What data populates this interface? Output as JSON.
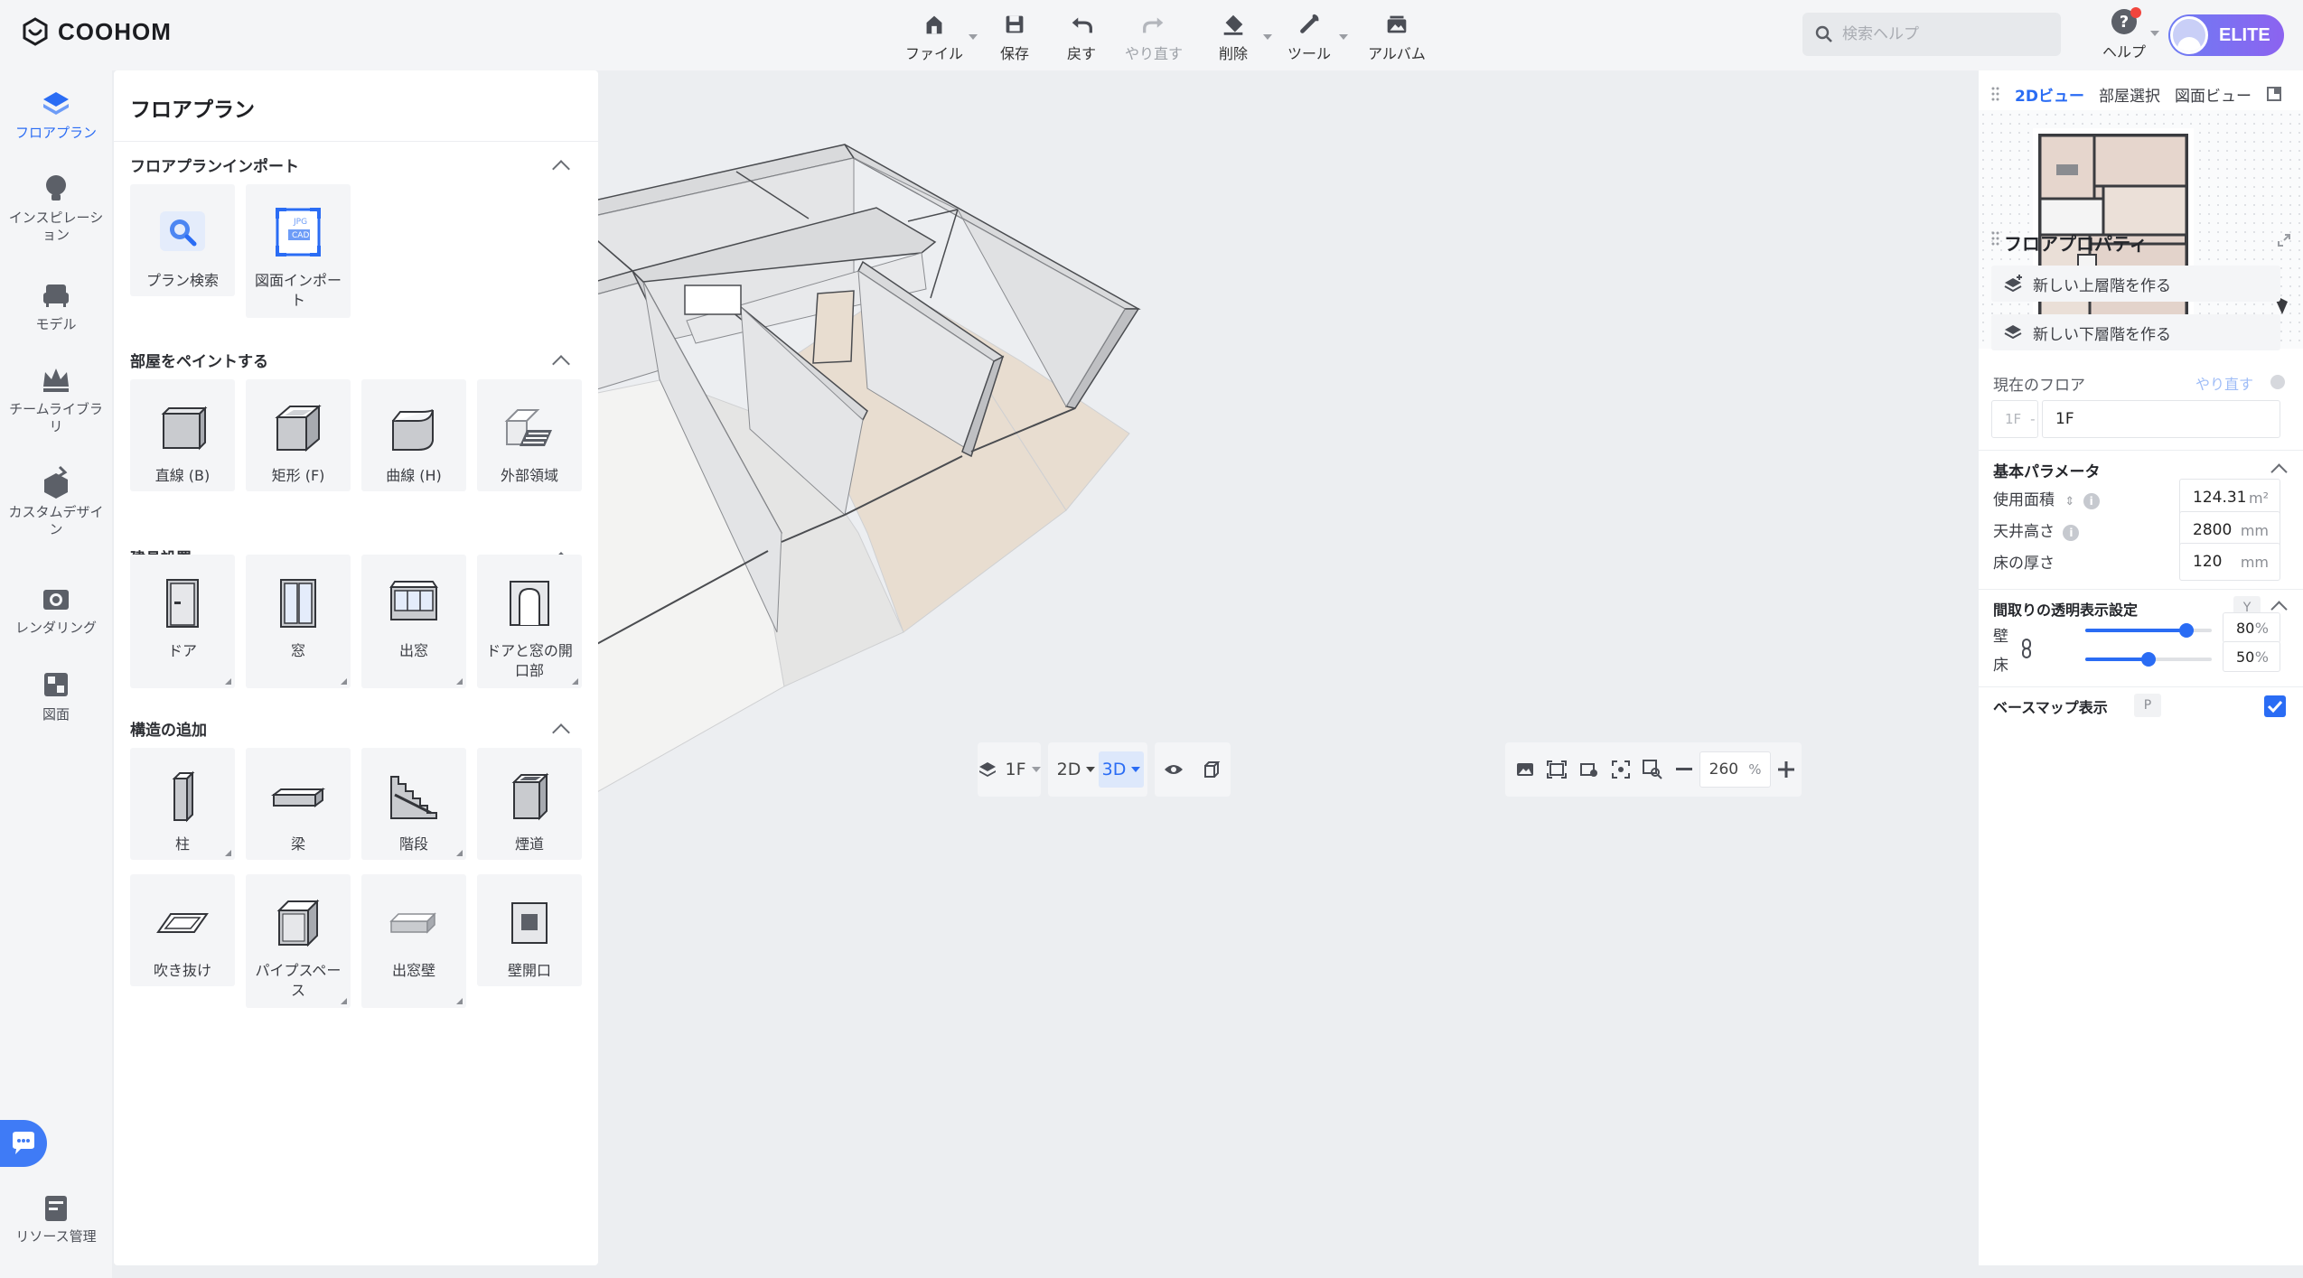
{
  "app": {
    "brand": "COOHOM"
  },
  "toolbar": {
    "file": "ファイル",
    "save": "保存",
    "undo": "戻す",
    "redo": "やり直す",
    "delete": "削除",
    "tools": "ツール",
    "album": "アルバム"
  },
  "search": {
    "placeholder": "検索ヘルプ"
  },
  "help": {
    "label": "ヘルプ"
  },
  "account": {
    "badge": "ELITE"
  },
  "rail": {
    "items": [
      {
        "label": "フロアプラン"
      },
      {
        "label": "インスピレーション"
      },
      {
        "label": "モデル"
      },
      {
        "label": "チームライブラリ"
      },
      {
        "label": "カスタムデザイン"
      },
      {
        "label": "レンダリング"
      },
      {
        "label": "図面"
      }
    ],
    "resource": "リソース管理"
  },
  "panel": {
    "title": "フロアプラン",
    "import": {
      "title": "フロアプランインポート",
      "items": [
        {
          "label": "プラン検索"
        },
        {
          "label": "図面インポート"
        }
      ],
      "cad_jpg": "JPG",
      "cad_cad": "CAD"
    },
    "paint": {
      "title": "部屋をペイントする",
      "items": [
        {
          "label": "直線 (B)"
        },
        {
          "label": "矩形 (F)"
        },
        {
          "label": "曲線 (H)"
        },
        {
          "label": "外部領域"
        }
      ]
    },
    "fixtures": {
      "title": "建具設置",
      "items": [
        {
          "label": "ドア"
        },
        {
          "label": "窓"
        },
        {
          "label": "出窓"
        },
        {
          "label": "ドアと窓の開口部"
        }
      ]
    },
    "structure": {
      "title": "構造の追加",
      "items": [
        {
          "label": "柱"
        },
        {
          "label": "梁"
        },
        {
          "label": "階段"
        },
        {
          "label": "煙道"
        },
        {
          "label": "吹き抜け"
        },
        {
          "label": "パイプスペース"
        },
        {
          "label": "出窓壁"
        },
        {
          "label": "壁開口"
        }
      ]
    }
  },
  "bottom": {
    "floor": "1F",
    "view2d": "2D",
    "view3d": "3D",
    "zoom": "260",
    "zoom_unit": "%"
  },
  "right": {
    "tabs": [
      "2Dビュー",
      "部屋選択",
      "図面ビュー"
    ],
    "props_title": "フロアプロパティ",
    "new_upper": "新しい上層階を作る",
    "new_lower": "新しい下層階を作る",
    "current_floor_label": "現在のフロア",
    "redo": "やり直す",
    "floor_prefix": "1F",
    "floor_value": "1F",
    "basic_title": "基本パラメータ",
    "area_label": "使用面積",
    "area_value": "124.31",
    "area_unit": "m²",
    "ceiling_label": "天井高さ",
    "ceiling_value": "2800",
    "ceiling_unit": "mm",
    "floor_thick_label": "床の厚さ",
    "floor_thick_value": "120",
    "floor_thick_unit": "mm",
    "transparency_title": "間取りの透明表示設定",
    "transparency_key": "Y",
    "wall_label": "壁",
    "wall_value": "80",
    "floor_label": "床",
    "floor_opacity_value": "50",
    "pct": "%",
    "basemap_label": "ベースマップ表示",
    "basemap_key": "P",
    "wall_level": 0.8,
    "floor_level": 0.5
  },
  "colors": {
    "accent": "#2a6cf4",
    "wood": "#e8ddd0"
  }
}
